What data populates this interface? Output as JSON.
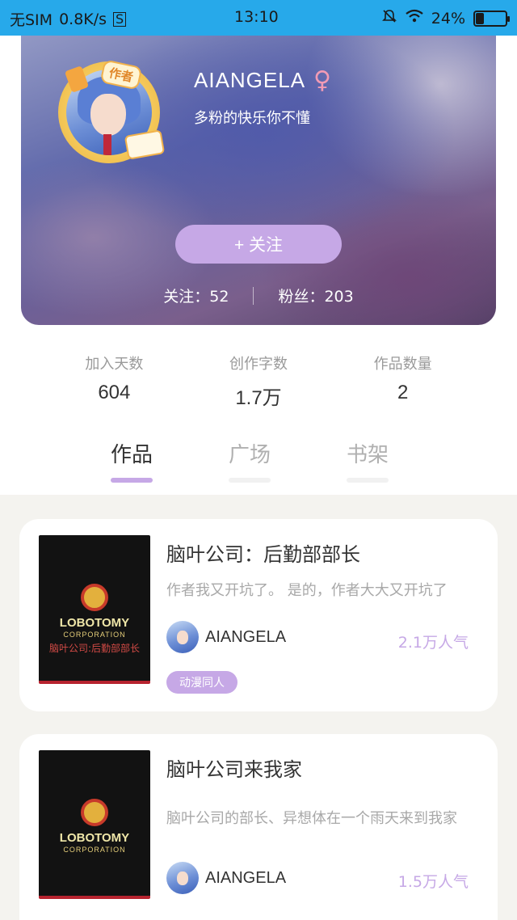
{
  "status_bar": {
    "carrier": "无SIM",
    "speed": "0.8K/s",
    "time": "13:10",
    "battery": "24%"
  },
  "profile": {
    "username": "AIANGELA",
    "gender_symbol": "♀",
    "signature": "多粉的快乐你不懂",
    "author_badge": "作者",
    "follow_label": "+  关注",
    "following": "关注：52",
    "followers": "粉丝：203"
  },
  "stats": [
    {
      "label": "加入天数",
      "value": "604"
    },
    {
      "label": "创作字数",
      "value": "1.7万"
    },
    {
      "label": "作品数量",
      "value": "2"
    }
  ],
  "tabs": [
    {
      "label": "作品",
      "active": true
    },
    {
      "label": "广场",
      "active": false
    },
    {
      "label": "书架",
      "active": false
    }
  ],
  "works": [
    {
      "title": "脑叶公司：后勤部部长",
      "description": "作者我又开坑了。        是的，作者大大又开坑了",
      "author": "AIANGELA",
      "popularity": "2.1万人气",
      "tag": "动漫同人",
      "cover_logo": "LOBOTOMY",
      "cover_sub": "CORPORATION",
      "cover_title": "脑叶公司:后勤部部长"
    },
    {
      "title": "脑叶公司来我家",
      "description": "脑叶公司的部长、异想体在一个雨天来到我家",
      "author": "AIANGELA",
      "popularity": "1.5万人气",
      "cover_logo": "LOBOTOMY",
      "cover_sub": "CORPORATION"
    }
  ],
  "colors": {
    "accent": "#c6a8e6",
    "status_bar": "#27a9ea",
    "gender": "#f29bb5"
  }
}
